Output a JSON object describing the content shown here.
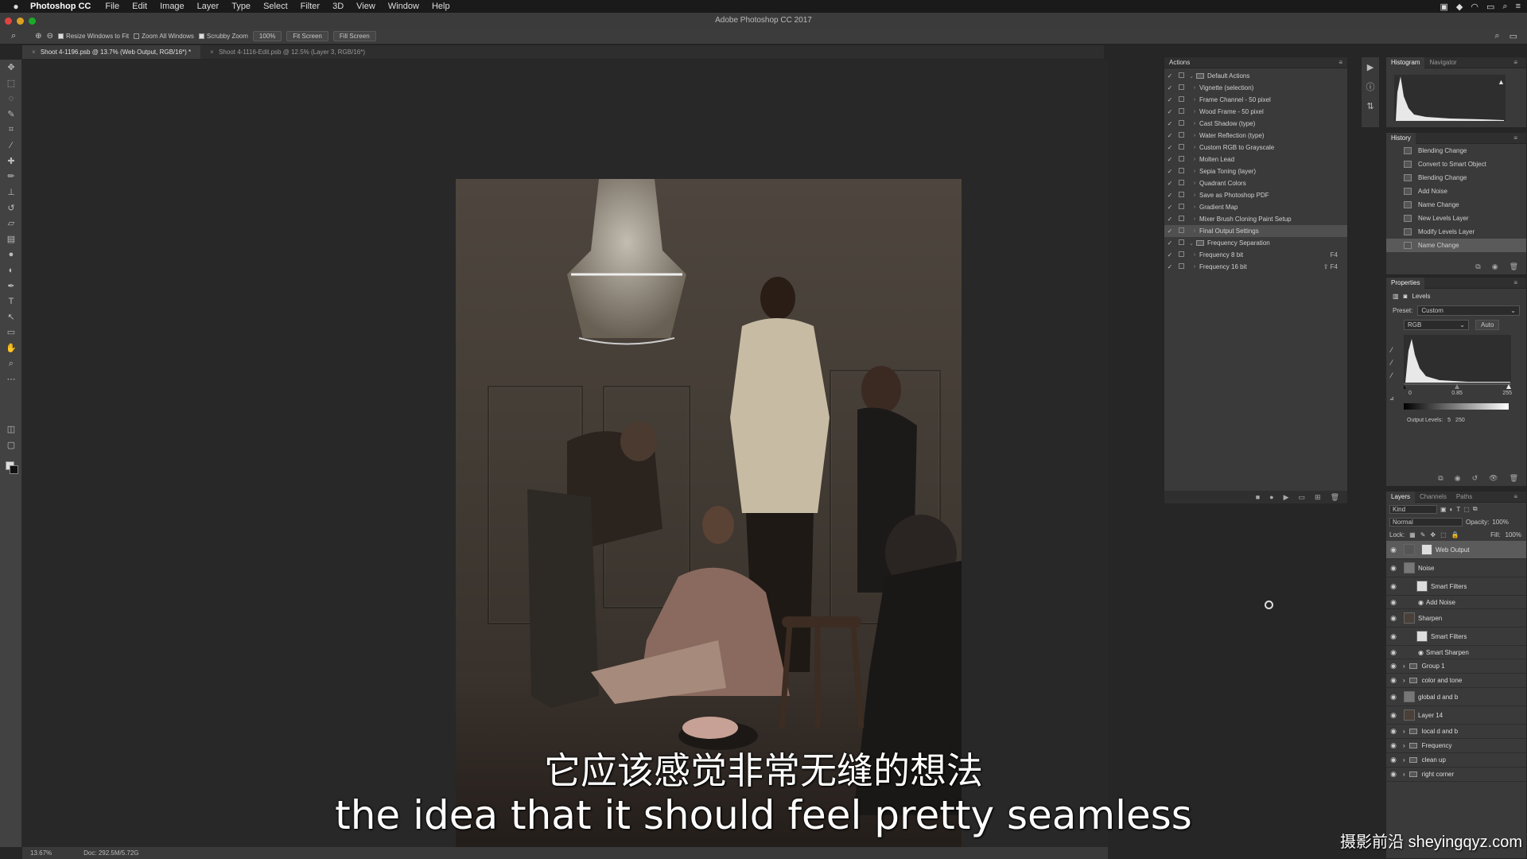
{
  "menubar": {
    "app_name": "Photoshop CC",
    "menus": [
      "File",
      "Edit",
      "Image",
      "Layer",
      "Type",
      "Select",
      "Filter",
      "3D",
      "View",
      "Window",
      "Help"
    ]
  },
  "window": {
    "title": "Adobe Photoshop CC 2017"
  },
  "options_bar": {
    "resize_windows": "Resize Windows to Fit",
    "zoom_all": "Zoom All Windows",
    "scrubby": "Scrubby Zoom",
    "zoom_pct": "100%",
    "fit_screen": "Fit Screen",
    "fill_screen": "Fill Screen"
  },
  "tabs": [
    {
      "label": "Shoot 4-1196.psb @ 13.7% (Web Output, RGB/16*) *"
    },
    {
      "label": "Shoot 4-1116-Edit.psb @ 12.5% (Layer 3, RGB/16*)"
    }
  ],
  "actions_panel": {
    "title": "Actions",
    "rows": [
      {
        "label": "Default Actions",
        "folder": true,
        "expanded": true
      },
      {
        "label": "Vignette (selection)"
      },
      {
        "label": "Frame Channel - 50 pixel"
      },
      {
        "label": "Wood Frame - 50 pixel"
      },
      {
        "label": "Cast Shadow (type)"
      },
      {
        "label": "Water Reflection (type)"
      },
      {
        "label": "Custom RGB to Grayscale"
      },
      {
        "label": "Molten Lead"
      },
      {
        "label": "Sepia Toning (layer)"
      },
      {
        "label": "Quadrant Colors"
      },
      {
        "label": "Save as Photoshop PDF"
      },
      {
        "label": "Gradient Map"
      },
      {
        "label": "Mixer Brush Cloning Paint Setup"
      },
      {
        "label": "Final Output Settings",
        "selected": true
      },
      {
        "label": "Frequency Separation",
        "folder": true,
        "expanded": true
      },
      {
        "label": "Frequency 8 bit",
        "key": "F4"
      },
      {
        "label": "Frequency 16 bit",
        "key": "⇧ F4"
      }
    ]
  },
  "histogram_panel": {
    "tabs": [
      "Histogram",
      "Navigator"
    ]
  },
  "history_panel": {
    "title": "History",
    "items": [
      "Blending Change",
      "Convert to Smart Object",
      "Blending Change",
      "Add Noise",
      "Name Change",
      "New Levels Layer",
      "Modify Levels Layer",
      "Name Change"
    ]
  },
  "properties_panel": {
    "title": "Properties",
    "adjustment": "Levels",
    "preset_label": "Preset:",
    "preset_value": "Custom",
    "channel": "RGB",
    "auto": "Auto",
    "input_levels": [
      "0",
      "0.85",
      "255"
    ],
    "output_label": "Output Levels:",
    "output_levels": [
      "5",
      "250"
    ]
  },
  "layers_panel": {
    "tabs": [
      "Layers",
      "Channels",
      "Paths"
    ],
    "kind": "Kind",
    "blend_mode": "Normal",
    "opacity_label": "Opacity:",
    "opacity": "100%",
    "lock_label": "Lock:",
    "fill_label": "Fill:",
    "fill": "100%",
    "layers": [
      {
        "name": "Web Output",
        "thumb": "levels",
        "selected": true
      },
      {
        "name": "Noise",
        "thumb": "gray"
      },
      {
        "name": "Smart Filters",
        "thumb": "white",
        "indent": true
      },
      {
        "name": "Add Noise",
        "indent": true,
        "filter": true
      },
      {
        "name": "Sharpen",
        "thumb": "dark"
      },
      {
        "name": "Smart Filters",
        "thumb": "white",
        "indent": true
      },
      {
        "name": "Smart Sharpen",
        "indent": true,
        "filter": true
      },
      {
        "name": "Group 1",
        "thumb": "folder"
      },
      {
        "name": "color and tone",
        "thumb": "folder"
      },
      {
        "name": "global d and b",
        "thumb": "gray"
      },
      {
        "name": "Layer 14",
        "thumb": "dark"
      },
      {
        "name": "local d and b",
        "thumb": "folder"
      },
      {
        "name": "Frequency",
        "thumb": "folder"
      },
      {
        "name": "clean up",
        "thumb": "folder"
      },
      {
        "name": "right corner",
        "thumb": "folder"
      }
    ]
  },
  "status": {
    "zoom": "13.67%",
    "doc": "Doc: 292.5M/5.72G"
  },
  "subtitles": {
    "chinese": "它应该感觉非常无缝的想法",
    "english": "the idea that it should feel pretty seamless"
  },
  "watermark": "摄影前沿 sheyingqyz.com"
}
